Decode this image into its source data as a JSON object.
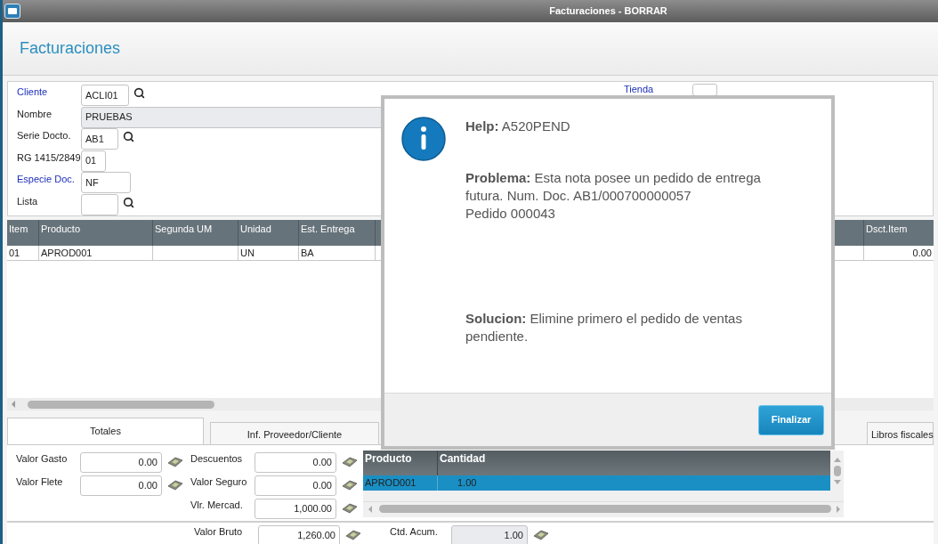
{
  "window": {
    "title": "Facturaciones - BORRAR"
  },
  "page": {
    "title": "Facturaciones"
  },
  "header_fields": [
    {
      "label": "Cliente",
      "value": "ACLI01",
      "link": true,
      "lookup": true,
      "readonly": false
    },
    {
      "label": "Nombre",
      "value": "PRUEBAS",
      "link": false,
      "lookup": false,
      "readonly": true
    },
    {
      "label": "Serie Docto.",
      "value": "AB1",
      "link": false,
      "lookup": true,
      "readonly": false
    },
    {
      "label": "RG 1415/2849",
      "value": "01",
      "link": false,
      "lookup": false,
      "readonly": false
    },
    {
      "label": "Especie Doc.",
      "value": "NF",
      "link": true,
      "lookup": false,
      "readonly": false
    },
    {
      "label": "Lista",
      "link": false,
      "lookup": true,
      "readonly": false
    }
  ],
  "store_field": {
    "label": "Tienda",
    "link": true
  },
  "items_grid": {
    "columns": [
      "Item",
      "Producto",
      "Segunda UM",
      "Unidad",
      "Est. Entrega",
      "Dsct.Item"
    ],
    "rows": [
      {
        "cells": [
          "01",
          "APROD001",
          null,
          "UN",
          "BA",
          "0.00"
        ],
        "selected": false
      }
    ]
  },
  "tabs": [
    {
      "label": "Totales",
      "selected": true
    },
    {
      "label": "Inf. Proveedor/Cliente",
      "selected": false
    },
    {
      "label": "Libros fiscales",
      "selected": false
    }
  ],
  "totals": {
    "left": [
      {
        "label": "Valor Gasto",
        "value": "0.00"
      },
      {
        "label": "Valor Flete",
        "value": "0.00"
      }
    ],
    "middle": [
      {
        "label": "Descuentos",
        "value": "0.00"
      },
      {
        "label": "Valor Seguro",
        "value": "0.00"
      },
      {
        "label": "Vlr. Mercad.",
        "value": "1,000.00"
      }
    ],
    "gross": {
      "label": "Valor Bruto",
      "value": "1,260.00"
    },
    "accumulated": {
      "label": "Ctd. Acum.",
      "value": "1.00",
      "readonly": true
    }
  },
  "products_grid": {
    "columns": [
      "Producto",
      "Cantidad"
    ],
    "rows": [
      {
        "cells": [
          "APROD001",
          "1.00"
        ],
        "selected": true
      }
    ]
  },
  "help_dialog": {
    "help": "**Help:** A520PEND",
    "problem": [
      "**Problema:** Esta nota posee un pedido de entrega futura. Num. Doc. AB1/000700000057",
      "Pedido 000043"
    ],
    "solution": "**Solucion:** Elimine primero el pedido de ventas pendiente.",
    "button": "Finalizar"
  }
}
